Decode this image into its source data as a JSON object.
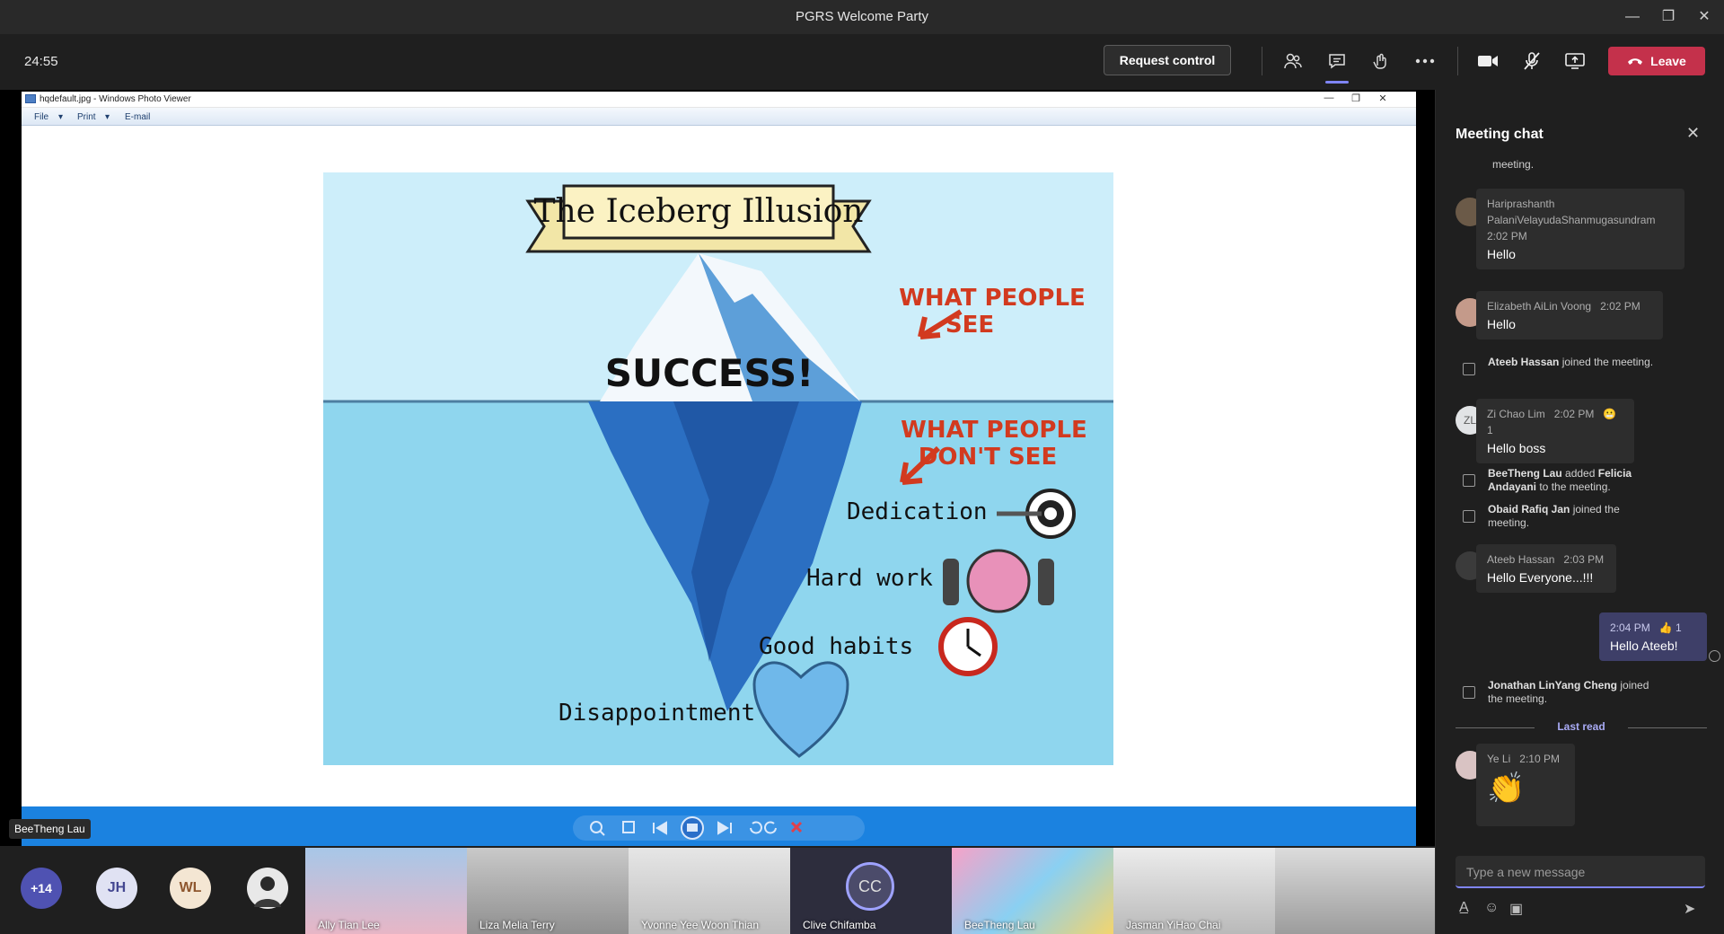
{
  "window": {
    "title": "PGRS Welcome Party"
  },
  "toolbar": {
    "timer": "24:55",
    "request_control": "Request control",
    "leave": "Leave"
  },
  "photo_viewer": {
    "title": "hqdefault.jpg - Windows Photo Viewer",
    "menu": [
      "File",
      "Print",
      "E-mail"
    ]
  },
  "image": {
    "banner": "The Iceberg Illusion",
    "success": "SUCCESS!",
    "see": [
      "WHAT PEOPLE",
      "SEE"
    ],
    "dont_see": [
      "WHAT PEOPLE",
      "DON'T SEE"
    ],
    "items": [
      "Dedication",
      "Hard work",
      "Good habits",
      "Disappointment"
    ]
  },
  "presenter": "BeeTheng Lau",
  "strip": {
    "more_count": "+14",
    "initials": [
      "JH",
      "WL"
    ],
    "tiles": [
      "Ally Tian Lee",
      "Liza Melia Terry",
      "Yvonne Yee Woon Thian",
      "Clive Chifamba",
      "BeeTheng Lau",
      "Jasman YiHao Chai",
      ""
    ],
    "clive_initials": "CC"
  },
  "chat": {
    "header": "Meeting chat",
    "top_fragment": "meeting.",
    "messages": [
      {
        "name": "Hariprashanth PalaniVelayudaShanmugasundram",
        "name_l1": "Hariprashanth",
        "name_l2": "PalaniVelayudaShanmugasundram",
        "time": "2:02 PM",
        "text": "Hello"
      },
      {
        "name": "Elizabeth AiLin Voong",
        "time": "2:02 PM",
        "text": "Hello"
      },
      {
        "name": "Zi Chao Lim",
        "initials": "ZL",
        "time": "2:02 PM",
        "text": "Hello boss",
        "reaction_count": "1"
      },
      {
        "name": "Ateeb Hassan",
        "time": "2:03 PM",
        "text": "Hello Everyone...!!!"
      },
      {
        "name": "",
        "time": "2:04 PM",
        "text": "Hello Ateeb!",
        "reaction_count": "1"
      },
      {
        "name": "Ye Li",
        "time": "2:10 PM",
        "text": ""
      }
    ],
    "system": [
      {
        "bold": "Ateeb Hassan",
        "rest": " joined the meeting."
      },
      {
        "bold": "BeeTheng Lau",
        "rest": " added ",
        "bold2": "Felicia Andayani",
        "rest2": " to the meeting."
      },
      {
        "bold": "Obaid Rafiq Jan",
        "rest": " joined the meeting."
      },
      {
        "bold": "Jonathan LinYang Cheng",
        "rest": " joined the meeting."
      }
    ],
    "last_read": "Last read",
    "input_placeholder": "Type a new message"
  }
}
